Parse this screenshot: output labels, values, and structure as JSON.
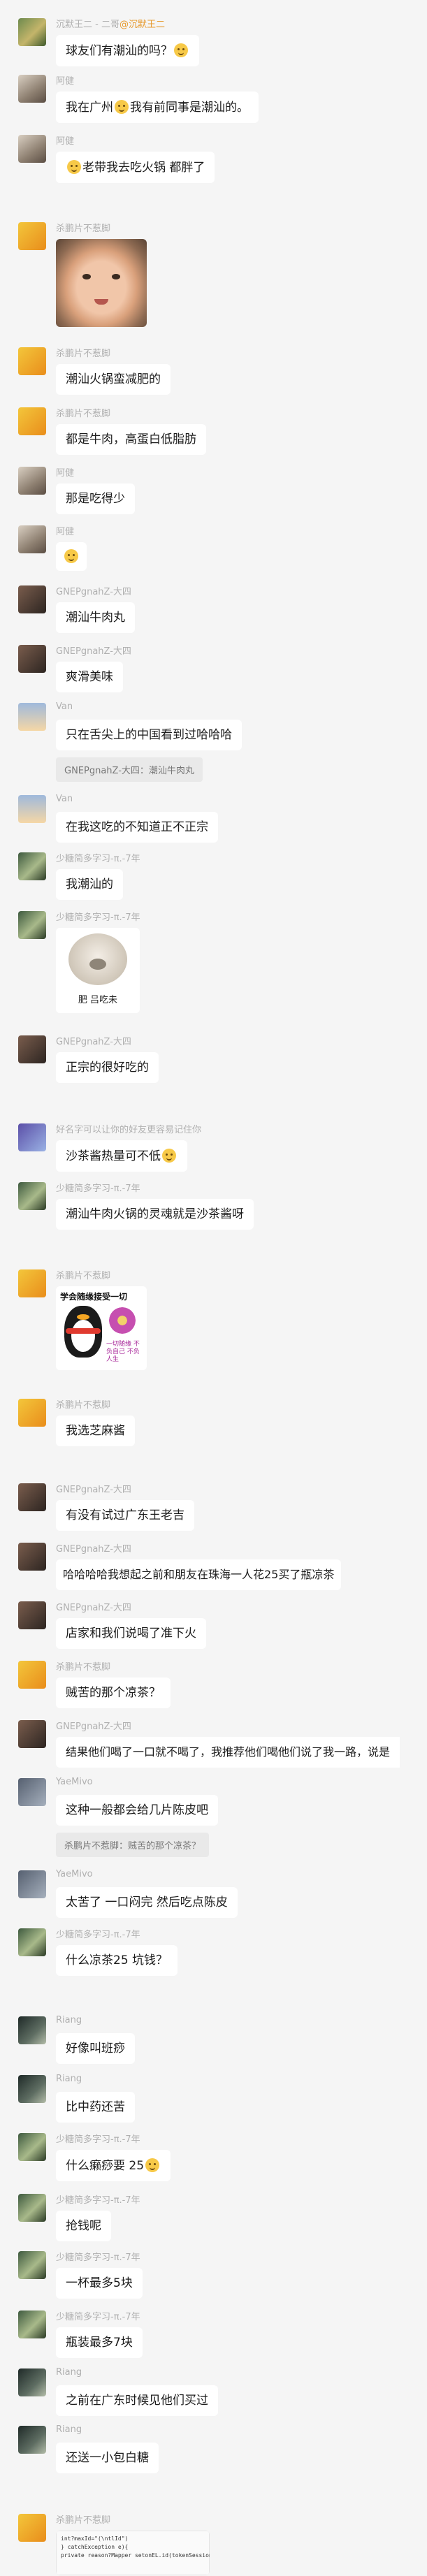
{
  "messages": [
    {
      "sender": "沉默王二 - 二哥",
      "mention": "@沉默王二",
      "text": "球友们有潮汕的吗？",
      "emoji_name": "grinning-face-icon"
    },
    {
      "sender": "阿健",
      "text": "我在广州",
      "text2": "我有前同事是潮汕的。",
      "emoji_name": "grinning-face-icon"
    },
    {
      "sender": "阿健",
      "text": "老带我去吃火锅 都胖了",
      "emoji_name": "grinning-face-icon"
    },
    {
      "sender": "杀鹏片不惹脚",
      "image": "baby-photo"
    },
    {
      "sender": "杀鹏片不惹脚",
      "text": "潮汕火锅蛮减肥的"
    },
    {
      "sender": "杀鹏片不惹脚",
      "text": "都是牛肉，高蛋白低脂肪"
    },
    {
      "sender": "阿健",
      "text": "那是吃得少"
    },
    {
      "sender": "阿健",
      "emoji_name": "grinning-face-icon"
    },
    {
      "sender": "GNEPgnahZ-大四",
      "text": "潮汕牛肉丸"
    },
    {
      "sender": "GNEPgnahZ-大四",
      "text": "爽滑美味"
    },
    {
      "sender": "Van",
      "text": "只在舌尖上的中国看到过哈哈哈",
      "quote": "GNEPgnahZ-大四：潮汕牛肉丸"
    },
    {
      "sender": "Van",
      "text": "在我这吃的不知道正不正宗"
    },
    {
      "sender": "少糖简多字习-π.-7年",
      "text": "我潮汕的"
    },
    {
      "sender": "少糖简多字习-π.-7年",
      "sticker_caption": "肥 吕吃未"
    },
    {
      "sender": "GNEPgnahZ-大四",
      "text": "正宗的很好吃的"
    },
    {
      "sender": "好名字可以让你的好友更容易记住你",
      "text": "沙茶酱热量可不低",
      "emoji_name": "grinning-face-icon"
    },
    {
      "sender": "少糖简多字习-π.-7年",
      "text": "潮汕牛肉火锅的灵魂就是沙茶酱呀"
    },
    {
      "sender": "杀鹏片不惹脚",
      "sticker_title": "学会随缘接受一切",
      "sticker_note": "一切随缘 不负自己 不负人生"
    },
    {
      "sender": "杀鹏片不惹脚",
      "text": "我选芝麻酱"
    },
    {
      "sender": "GNEPgnahZ-大四",
      "text": "有没有试过广东王老吉"
    },
    {
      "sender": "GNEPgnahZ-大四",
      "text": "哈哈哈哈我想起之前和朋友在珠海一人花25买了瓶凉茶"
    },
    {
      "sender": "GNEPgnahZ-大四",
      "text": "店家和我们说喝了准下火"
    },
    {
      "sender": "杀鹏片不惹脚",
      "text": "贼苦的那个凉茶？"
    },
    {
      "sender": "GNEPgnahZ-大四",
      "text": "结果他们喝了一口就不喝了，我推荐他们喝他们说了我一路，说是"
    },
    {
      "sender": "YaeMivo",
      "text": "这种一般都会给几片陈皮吧",
      "quote": "杀鹏片不惹脚：贼苦的那个凉茶？"
    },
    {
      "sender": "YaeMivo",
      "text": "太苦了 一口闷完 然后吃点陈皮"
    },
    {
      "sender": "少糖简多字习-π.-7年",
      "text": "什么凉茶25 坑钱？"
    },
    {
      "sender": "Riang",
      "text": "好像叫班痧"
    },
    {
      "sender": "Riang",
      "text": "比中药还苦"
    },
    {
      "sender": "少糖简多字习-π.-7年",
      "text": "什么癞痧要 25",
      "emoji_name": "laughing-face-icon"
    },
    {
      "sender": "少糖简多字习-π.-7年",
      "text": "抢钱呢"
    },
    {
      "sender": "少糖简多字习-π.-7年",
      "text": "一杯最多5块"
    },
    {
      "sender": "少糖简多字习-π.-7年",
      "text": "瓶装最多7块"
    },
    {
      "sender": "Riang",
      "text": "之前在广东时候见他们买过"
    },
    {
      "sender": "Riang",
      "text": "还送一小包白糖"
    },
    {
      "sender": "杀鹏片不惹脚",
      "code_lines": [
        "int?maxId=\"(\\ntlId\")",
        "} catchException e){",
        "private reason?Mapper setonEL.id(tokenSession.null);",
        ""
      ]
    }
  ]
}
